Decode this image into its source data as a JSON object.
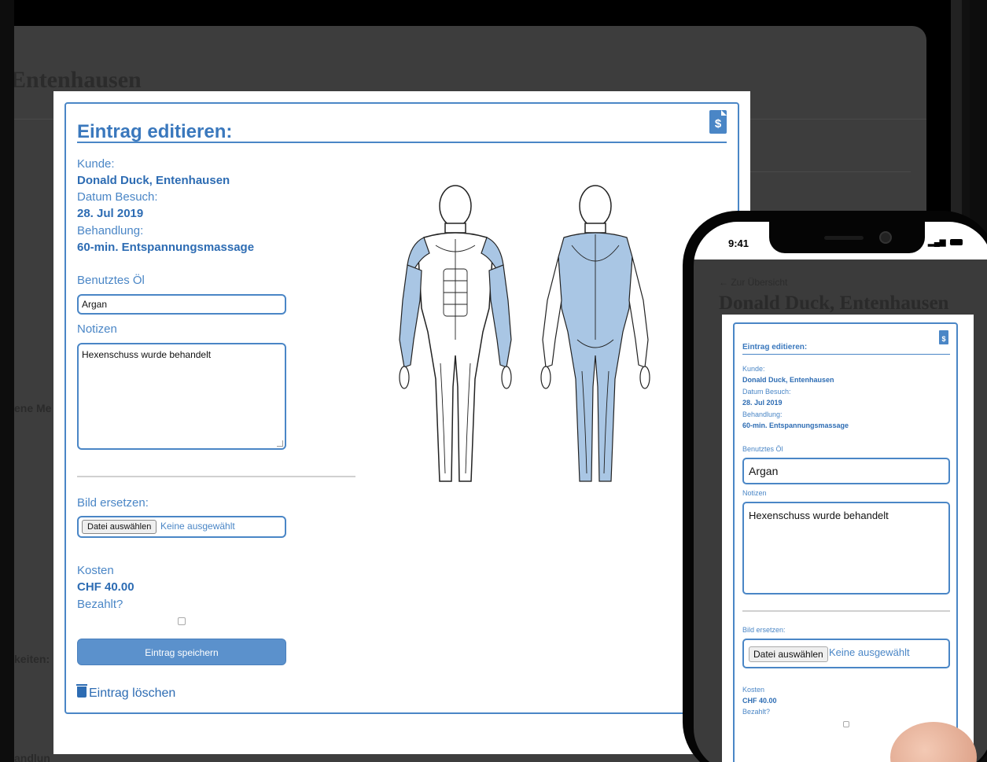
{
  "background": {
    "title_fragment": ", Entenhausen",
    "side_labels": [
      "ene Me",
      "",
      "keiten:",
      "andlun"
    ]
  },
  "card": {
    "title": "Eintrag editieren:",
    "doc_icon_glyph": "$",
    "kunde_label": "Kunde:",
    "kunde_value": "Donald Duck, Entenhausen",
    "datum_label": "Datum Besuch:",
    "datum_value": "28. Jul 2019",
    "behandlung_label": "Behandlung:",
    "behandlung_value": "60-min. Entspannungsmassage",
    "oil_label": "Benutztes Öl",
    "oil_value": "Argan",
    "notes_label": "Notizen",
    "notes_value": "Hexenschuss wurde behandelt",
    "image_label": "Bild ersetzen:",
    "file_button": "Datei auswählen",
    "file_status": "Keine ausgewählt",
    "cost_label": "Kosten",
    "cost_value": "CHF 40.00",
    "paid_label": "Bezahlt?",
    "paid_checked": false,
    "save_button": "Eintrag speichern",
    "delete_link": "Eintrag löschen"
  },
  "phone": {
    "time": "9:41",
    "back_link": "← Zur Übersicht",
    "page_title": "Donald Duck, Entenhausen",
    "card": {
      "title": "Eintrag editieren:",
      "kunde_label": "Kunde:",
      "kunde_value": "Donald Duck, Entenhausen",
      "datum_label": "Datum Besuch:",
      "datum_value": "28. Jul 2019",
      "behandlung_label": "Behandlung:",
      "behandlung_value": "60-min. Entspannungsmassage",
      "oil_label": "Benutztes Öl",
      "oil_value": "Argan",
      "notes_label": "Notizen",
      "notes_value": "Hexenschuss wurde behandelt",
      "image_label": "Bild ersetzen:",
      "file_button": "Datei auswählen",
      "file_status": "Keine ausgewählt",
      "cost_label": "Kosten",
      "cost_value": "CHF 40.00",
      "paid_label": "Bezahlt?"
    }
  },
  "colors": {
    "accent": "#4a86c6",
    "accent_dark": "#2d6cb3",
    "highlight_muscle": "#a9c6e4",
    "button": "#5b91cc"
  }
}
